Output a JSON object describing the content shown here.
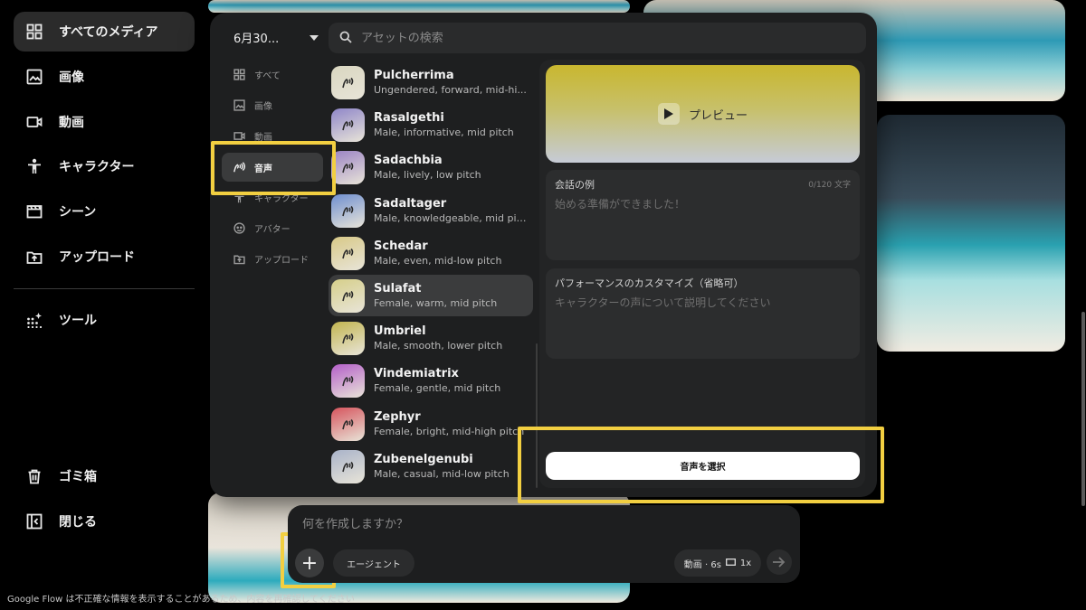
{
  "nav": {
    "items": [
      {
        "label": "すべてのメディア",
        "icon": "grid-icon"
      },
      {
        "label": "画像",
        "icon": "image-icon"
      },
      {
        "label": "動画",
        "icon": "video-icon"
      },
      {
        "label": "キャラクター",
        "icon": "person-icon"
      },
      {
        "label": "シーン",
        "icon": "scene-icon"
      },
      {
        "label": "アップロード",
        "icon": "upload-icon"
      },
      {
        "label": "ツール",
        "icon": "tools-icon"
      },
      {
        "label": "ゴミ箱",
        "icon": "trash-icon"
      },
      {
        "label": "閉じる",
        "icon": "collapse-icon"
      }
    ]
  },
  "panel": {
    "date_filter": "6月30...",
    "search_placeholder": "アセットの検索",
    "categories": [
      {
        "label": "すべて",
        "icon": "grid-icon"
      },
      {
        "label": "画像",
        "icon": "image-icon"
      },
      {
        "label": "動画",
        "icon": "video-icon"
      },
      {
        "label": "音声",
        "icon": "voice-icon"
      },
      {
        "label": "キャラクター",
        "icon": "person-icon"
      },
      {
        "label": "アバター",
        "icon": "avatar-icon"
      },
      {
        "label": "アップロード",
        "icon": "upload-icon"
      }
    ],
    "voices": [
      {
        "name": "Pulcherrima",
        "desc": "Ungendered, forward, mid-hi...",
        "color": "#d9d6c0"
      },
      {
        "name": "Rasalgethi",
        "desc": "Male, informative, mid pitch",
        "color": "#8f86c9"
      },
      {
        "name": "Sadachbia",
        "desc": "Male, lively, low pitch",
        "color": "#9a82c4"
      },
      {
        "name": "Sadaltager",
        "desc": "Male, knowledgeable, mid pit...",
        "color": "#6f8fd0"
      },
      {
        "name": "Schedar",
        "desc": "Male, even, mid-low pitch",
        "color": "#d8c987"
      },
      {
        "name": "Sulafat",
        "desc": "Female, warm, mid pitch",
        "color": "#d6cf8a"
      },
      {
        "name": "Umbriel",
        "desc": "Male, smooth, lower pitch",
        "color": "#c2b550"
      },
      {
        "name": "Vindemiatrix",
        "desc": "Female, gentle, mid pitch",
        "color": "#b45fc9"
      },
      {
        "name": "Zephyr",
        "desc": "Female, bright, mid-high pitch",
        "color": "#d6545d"
      },
      {
        "name": "Zubenelgenubi",
        "desc": "Male, casual, mid-low pitch",
        "color": "#a9b3c9"
      }
    ],
    "preview_label": "プレビュー",
    "example_label": "会話の例",
    "example_count": "0/120 文字",
    "example_placeholder": "始める準備ができました！",
    "customize_label": "パフォーマンスのカスタマイズ（省略可）",
    "customize_placeholder": "キャラクターの声について説明してください",
    "select_button": "音声を選択"
  },
  "prompt": {
    "placeholder": "何を作成しますか？",
    "agent_label": "エージェント",
    "settings_label": "動画 · 6s",
    "multiplier": "1x"
  },
  "disclaimer": "Google Flow は不正確な情報を表示することがあるため、内容を再確認してください"
}
